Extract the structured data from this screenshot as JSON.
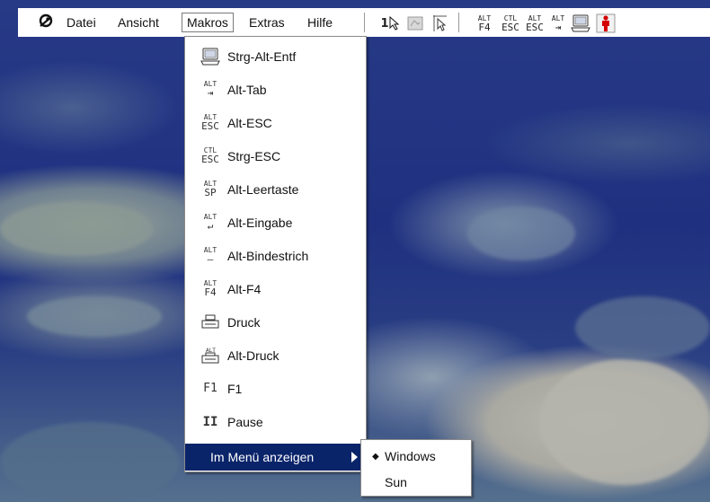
{
  "menubar": {
    "items": [
      {
        "label": "Datei"
      },
      {
        "label": "Ansicht"
      },
      {
        "label": "Makros"
      },
      {
        "label": "Extras"
      },
      {
        "label": "Hilfe"
      }
    ],
    "toolbar": {
      "number_one": "1",
      "alt_f4": {
        "top": "ALT",
        "bottom": "F4"
      },
      "ctl_esc": {
        "top": "CTL",
        "bottom": "ESC"
      },
      "alt_esc": {
        "top": "ALT",
        "bottom": "ESC"
      },
      "alt_tab": {
        "top": "ALT",
        "bottom": "⇥"
      }
    }
  },
  "makros_menu": {
    "items": [
      {
        "label": "Strg-Alt-Entf",
        "icon": "computer-icon"
      },
      {
        "label": "Alt-Tab",
        "icon_top": "ALT",
        "icon_bottom": "⇥"
      },
      {
        "label": "Alt-ESC",
        "icon_top": "ALT",
        "icon_bottom": "ESC"
      },
      {
        "label": "Strg-ESC",
        "icon_top": "CTL",
        "icon_bottom": "ESC"
      },
      {
        "label": "Alt-Leertaste",
        "icon_top": "ALT",
        "icon_bottom": "SP"
      },
      {
        "label": "Alt-Eingabe",
        "icon_top": "ALT",
        "icon_bottom": "↵"
      },
      {
        "label": "Alt-Bindestrich",
        "icon_top": "ALT",
        "icon_bottom": "—"
      },
      {
        "label": "Alt-F4",
        "icon_top": "ALT",
        "icon_bottom": "F4"
      },
      {
        "label": "Druck",
        "icon": "printer-icon"
      },
      {
        "label": "Alt-Druck",
        "icon": "alt-printer-icon"
      },
      {
        "label": "F1",
        "icon_text": "F1"
      },
      {
        "label": "Pause",
        "icon_text": "II"
      }
    ],
    "show_in_menu": {
      "label": "Im Menü anzeigen"
    }
  },
  "submenu": {
    "items": [
      {
        "label": "Windows",
        "selected_mark": "◆"
      },
      {
        "label": "Sun",
        "selected_mark": ""
      }
    ]
  }
}
